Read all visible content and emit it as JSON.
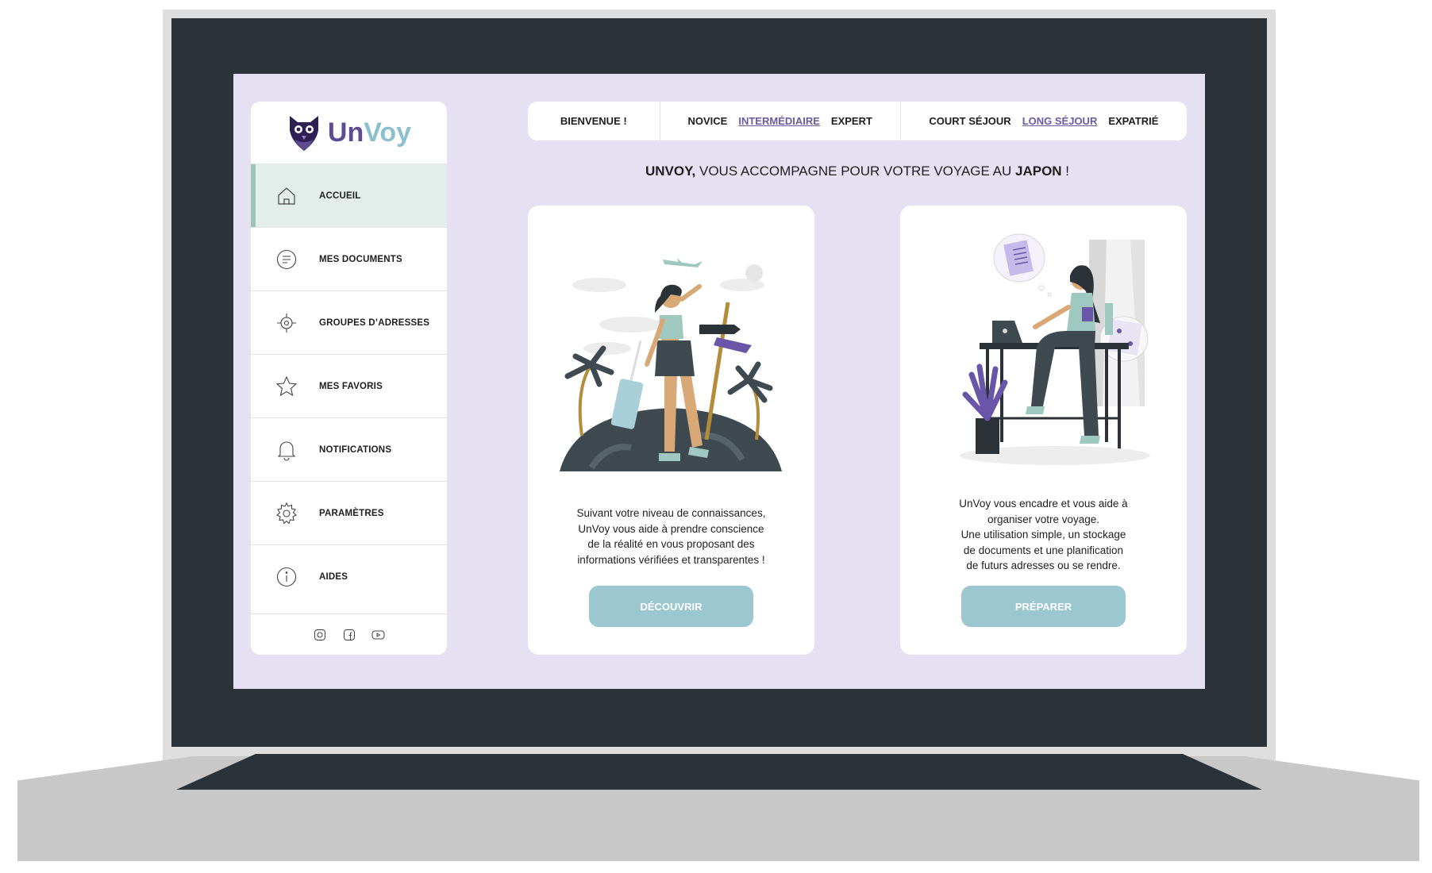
{
  "brand": {
    "name_part1": "Un",
    "name_part2": "Voy"
  },
  "sidebar": {
    "items": [
      {
        "label": "ACCUEIL",
        "icon": "home-icon",
        "active": true
      },
      {
        "label": "MES DOCUMENTS",
        "icon": "document-icon"
      },
      {
        "label": "GROUPES D’ADRESSES",
        "icon": "location-target-icon"
      },
      {
        "label": "MES FAVORIS",
        "icon": "star-icon"
      },
      {
        "label": "NOTIFICATIONS",
        "icon": "bell-icon"
      },
      {
        "label": "PARAMÈTRES",
        "icon": "gear-icon"
      },
      {
        "label": "AIDES",
        "icon": "info-icon"
      }
    ],
    "social": [
      "instagram-icon",
      "facebook-icon",
      "youtube-icon"
    ]
  },
  "topbar": {
    "welcome": "BIENVENUE !",
    "levels": [
      {
        "label": "NOVICE"
      },
      {
        "label": "INTERMÉDIAIRE",
        "selected": true
      },
      {
        "label": "EXPERT"
      }
    ],
    "durations": [
      {
        "label": "COURT SÉJOUR"
      },
      {
        "label": "LONG SÉJOUR",
        "selected": true
      },
      {
        "label": "EXPATRIÉ"
      }
    ]
  },
  "headline": {
    "brand": "UNVOY,",
    "middle": " VOUS ACCOMPAGNE POUR VOTRE VOYAGE AU ",
    "country": "JAPON",
    "end": " !"
  },
  "cards": [
    {
      "lines": [
        "Suivant votre niveau de connaissances,",
        "UnVoy vous aide à prendre conscience",
        "de la réalité en vous proposant des",
        "informations vérifiées et transparentes !"
      ],
      "button": "DÉCOUVRIR"
    },
    {
      "lines": [
        "UnVoy vous encadre et vous aide à",
        "organiser votre voyage.",
        "Une utilisation simple, un stockage",
        "de documents et une planification",
        "de futurs adresses ou se rendre."
      ],
      "button": "PRÉPARER"
    }
  ],
  "colors": {
    "screen_bg": "#e6e1f2",
    "brand_purple": "#5e4b92",
    "brand_teal": "#8cc0cf",
    "button": "#9bc7d0",
    "active_nav": "#e3eeea",
    "selected_link": "#6a5aa0",
    "laptop_dark": "#2c3338"
  }
}
